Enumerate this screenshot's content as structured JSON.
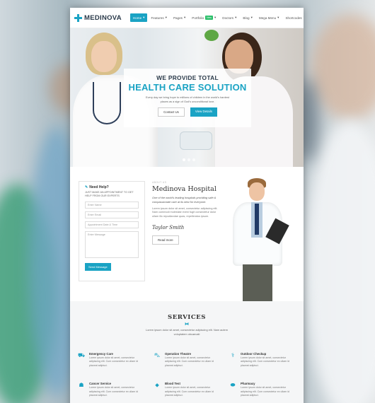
{
  "brand": {
    "name": "MEDINOVA",
    "accent": "#1aa3c4"
  },
  "nav": {
    "items": [
      {
        "label": "Home",
        "active": true
      },
      {
        "label": "Features",
        "active": false
      },
      {
        "label": "Pages",
        "active": false
      },
      {
        "label": "Portfolio",
        "active": false,
        "badge": "New"
      },
      {
        "label": "Doctors",
        "active": false
      },
      {
        "label": "Blog",
        "active": false
      },
      {
        "label": "Mega Menu",
        "active": false
      },
      {
        "label": "Shortcodes",
        "active": false
      }
    ]
  },
  "hero": {
    "kicker": "WE PROVIDE TOTAL",
    "title": "HEALTH CARE SOLUTION",
    "text": "Every day we bring hope to millions of children in the world's hardest places as a sign of God's unconditional love.",
    "btn_contact": "Contact Us",
    "btn_details": "View Details"
  },
  "appointment": {
    "title": "Need Help?",
    "subtitle": "JUST MAKE AN APPOINTMENT TO GET HELP FROM OUR EXPERTS",
    "name_placeholder": "Enter Name",
    "email_placeholder": "Enter Email",
    "date_placeholder": "Appointment Date & Time",
    "message_placeholder": "Enter Message",
    "send_label": "Send Message"
  },
  "about": {
    "kicker": "ABOUT US",
    "title": "Medinova Hospital",
    "lead": "One of the world's leading hospitals providing safe & compassionate care at its best for everyone.",
    "body": "Lorem ipsum dolor sit amet, consectetur adipiscing elit. Nam commodi molestiae eveni fugit consectetur dolor ullam illo repudiandae quas, repellendus ipsum.",
    "signature": "Taylor Smith",
    "read_more": "Read more"
  },
  "services": {
    "title": "SERVICES",
    "intro": "Lorem ipsum dolor sit amet, consectetur adipiscing elit. Nam autem voluptatem obcaecati",
    "items": [
      {
        "name": "Emergency Care",
        "icon": "ambulance-icon",
        "glyph": "⛟",
        "desc": "Lorem ipsum dolor sit amet, consectetur adipiscing elit. Cum consectetur ex ullam id placeat adipisci."
      },
      {
        "name": "Operation Theatre",
        "icon": "bed-icon",
        "glyph": "⛍",
        "desc": "Lorem ipsum dolor sit amet, consectetur adipiscing elit. Cum consectetur ex ullam id placeat adipisci."
      },
      {
        "name": "Outdoor Checkup",
        "icon": "stethoscope-icon",
        "glyph": "⚕",
        "desc": "Lorem ipsum dolor sit amet, consectetur adipiscing elit. Cum consectetur ex ullam id placeat adipisci."
      },
      {
        "name": "Cancer Service",
        "icon": "doctor-icon",
        "glyph": "☗",
        "desc": "Lorem ipsum dolor sit amet, consectetur adipiscing elit. Cum consectetur ex ullam id placeat adipisci."
      },
      {
        "name": "Blood Test",
        "icon": "blood-drop-icon",
        "glyph": "⬥",
        "desc": "Lorem ipsum dolor sit amet, consectetur adipiscing elit. Cum consectetur ex ullam id placeat adipisci."
      },
      {
        "name": "Pharmacy",
        "icon": "pill-icon",
        "glyph": "⬬",
        "desc": "Lorem ipsum dolor sit amet, consectetur adipiscing elit. Cum consectetur ex ullam id placeat adipisci."
      }
    ]
  }
}
